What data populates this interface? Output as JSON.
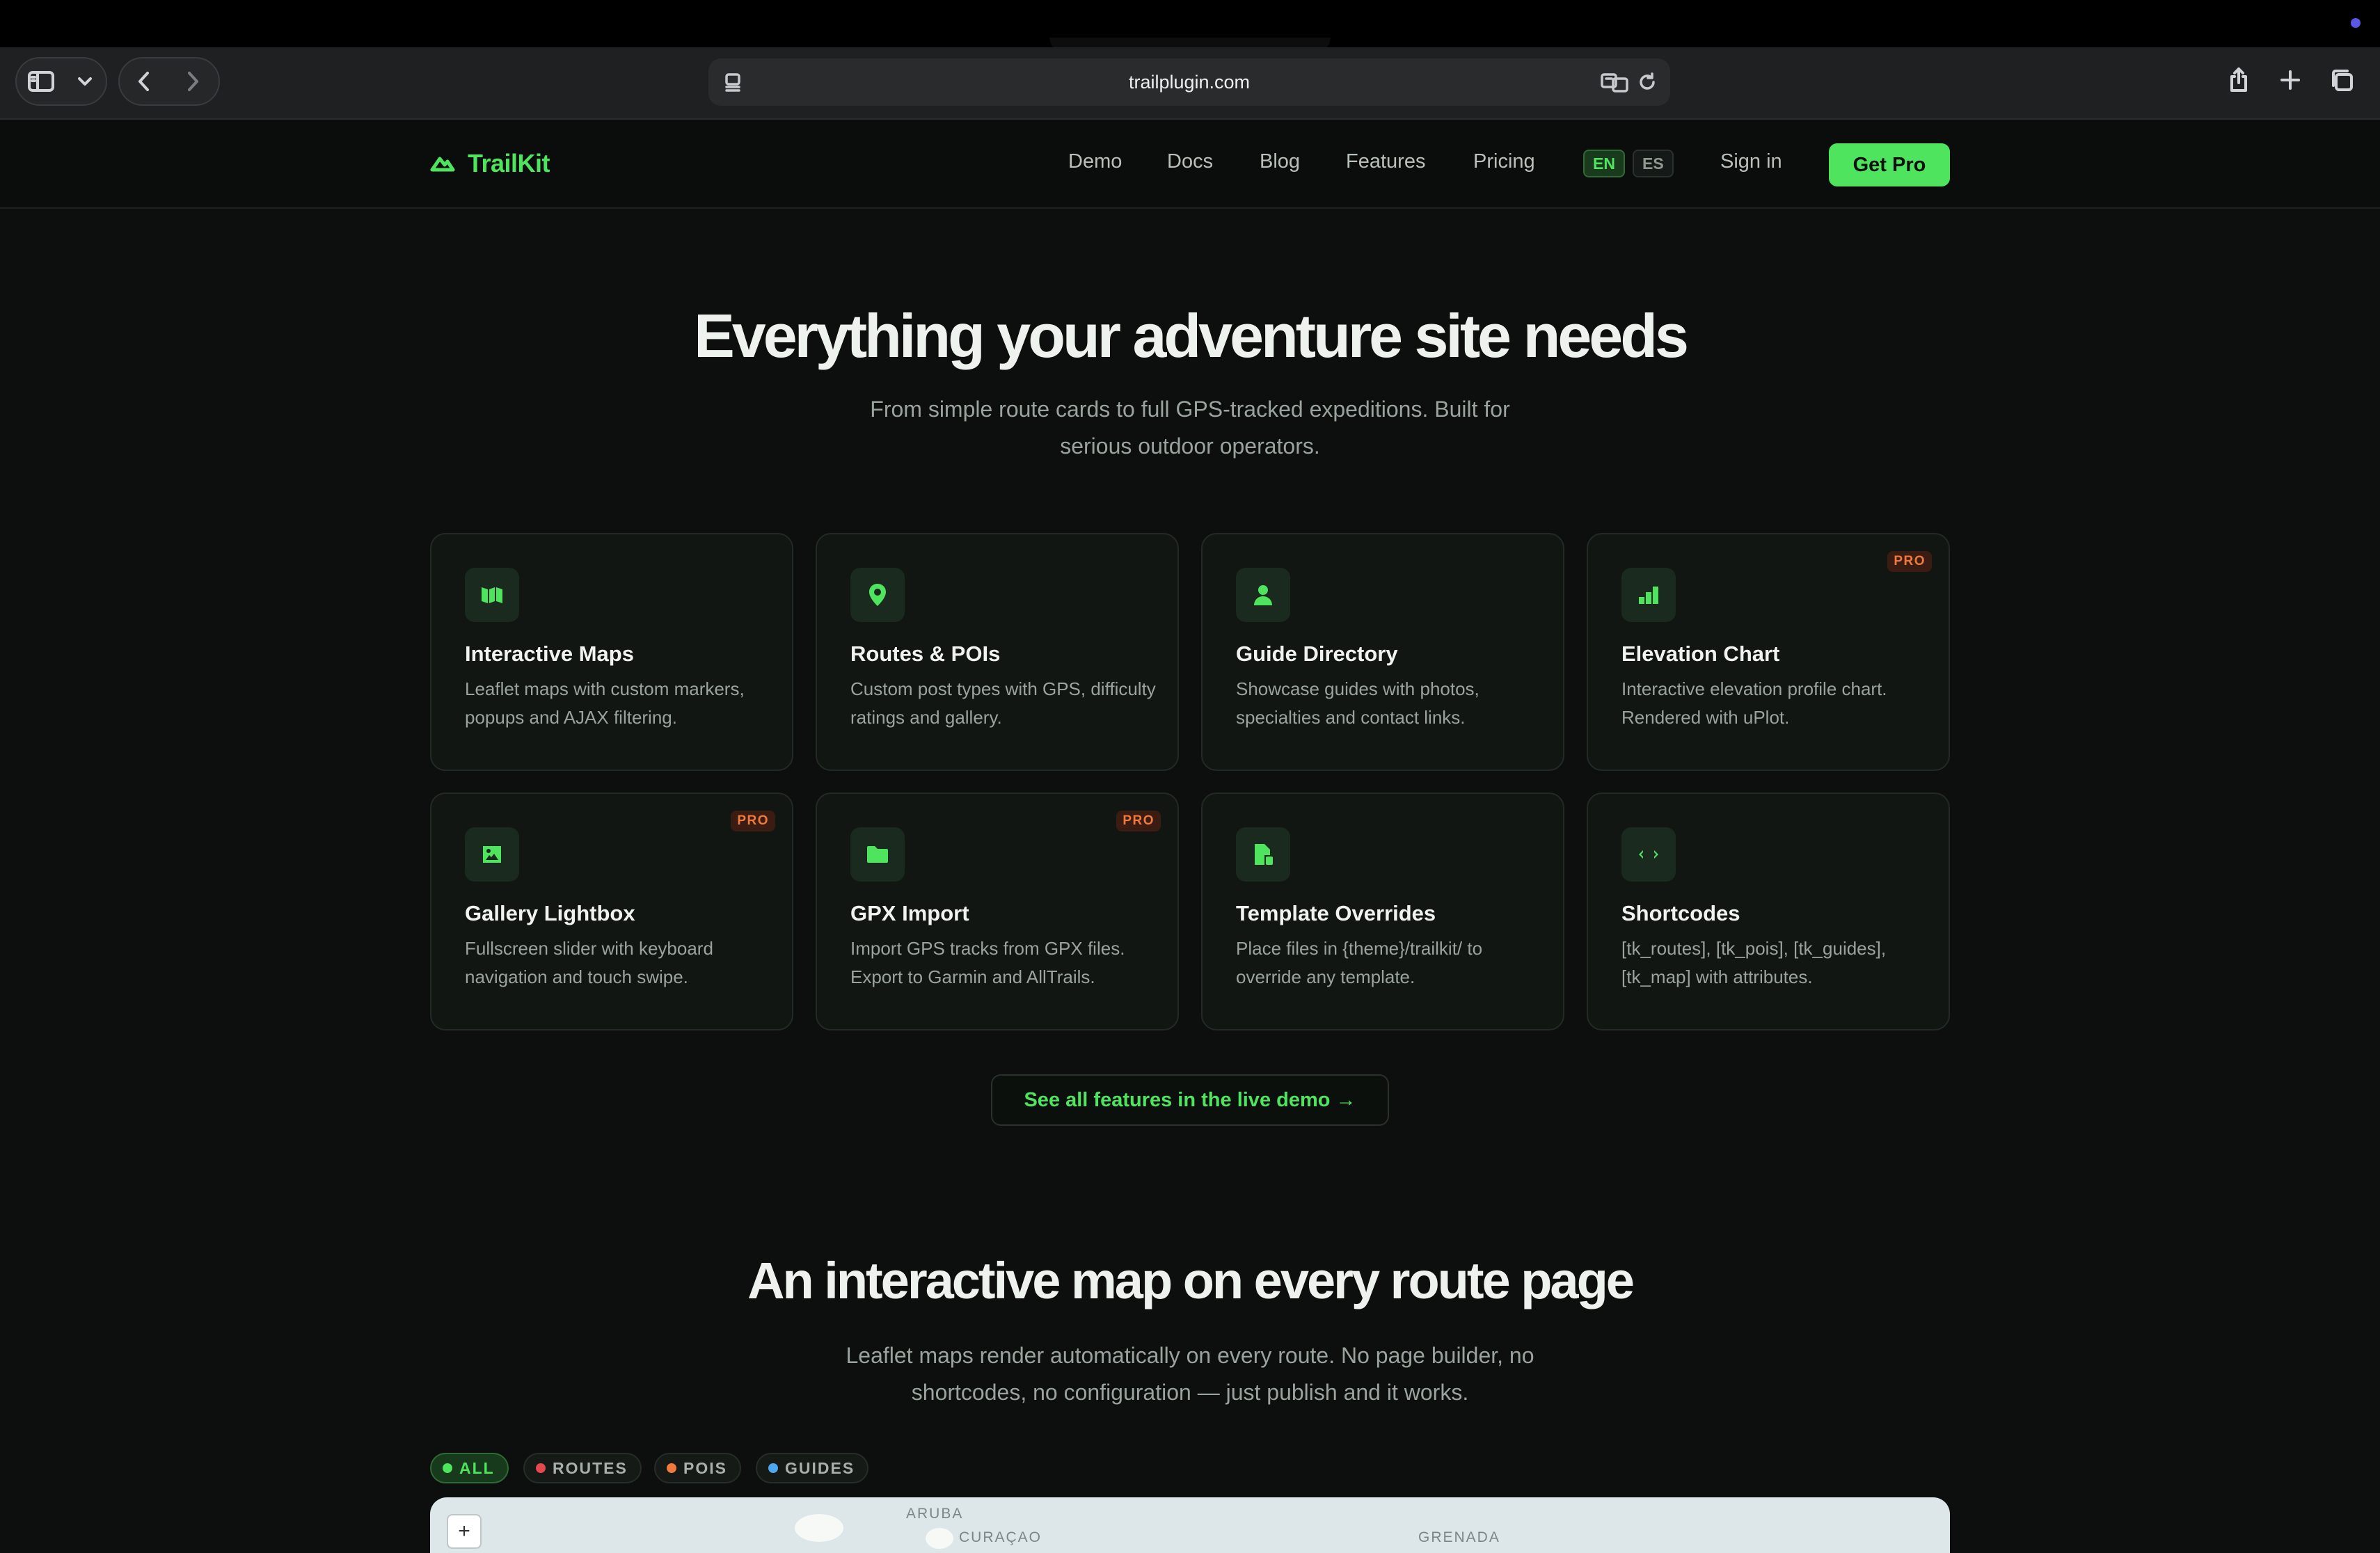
{
  "browser": {
    "url": "trailplugin.com"
  },
  "nav": {
    "brand": "TrailKit",
    "links": [
      "Demo",
      "Docs",
      "Blog",
      "Features",
      "Pricing"
    ],
    "lang_en": "EN",
    "lang_es": "ES",
    "signin": "Sign in",
    "cta": "Get Pro"
  },
  "features": {
    "title": "Everything your adventure site needs",
    "subtitle_line1": "From simple route cards to full GPS-tracked expeditions. Built for",
    "subtitle_line2": "serious outdoor operators.",
    "pro_badge": "PRO",
    "cards": [
      {
        "title": "Interactive Maps",
        "desc": "Leaflet maps with custom markers, popups and AJAX filtering.",
        "icon": "map-icon",
        "pro": false
      },
      {
        "title": "Routes & POIs",
        "desc": "Custom post types with GPS, difficulty ratings and gallery.",
        "icon": "location-pin-icon",
        "pro": false
      },
      {
        "title": "Guide Directory",
        "desc": "Showcase guides with photos, specialties and contact links.",
        "icon": "person-icon",
        "pro": false
      },
      {
        "title": "Elevation Chart",
        "desc": "Interactive elevation profile chart. Rendered with uPlot.",
        "icon": "bar-chart-icon",
        "pro": true
      },
      {
        "title": "Gallery Lightbox",
        "desc": "Fullscreen slider with keyboard navigation and touch swipe.",
        "icon": "image-icon",
        "pro": true
      },
      {
        "title": "GPX Import",
        "desc": "Import GPS tracks from GPX files. Export to Garmin and AllTrails.",
        "icon": "folder-icon",
        "pro": true
      },
      {
        "title": "Template Overrides",
        "desc": "Place files in {theme}/trailkit/ to override any template.",
        "icon": "file-icon",
        "pro": false
      },
      {
        "title": "Shortcodes",
        "desc": "[tk_routes], [tk_pois], [tk_guides], [tk_map] with attributes.",
        "icon": "code-icon",
        "pro": false
      }
    ],
    "demo_button": "See all features in the live demo →"
  },
  "map_section": {
    "title": "An interactive map on every route page",
    "subtitle_line1": "Leaflet maps render automatically on every route. No page builder, no",
    "subtitle_line2": "shortcodes, no configuration — just publish and it works.",
    "filters": [
      {
        "label": "ALL",
        "color": "#4ee45e",
        "active": true
      },
      {
        "label": "ROUTES",
        "color": "#e5484d",
        "active": false
      },
      {
        "label": "POIS",
        "color": "#f07a3c",
        "active": false
      },
      {
        "label": "GUIDES",
        "color": "#4ea8f0",
        "active": false
      }
    ],
    "map": {
      "zoom_in": "+",
      "labels": [
        "ARUBA",
        "CURAÇAO",
        "GRENADA"
      ]
    }
  },
  "colors": {
    "accent": "#4ee45e",
    "background": "#0c0f0d",
    "pro_badge": "#f07a3c"
  }
}
